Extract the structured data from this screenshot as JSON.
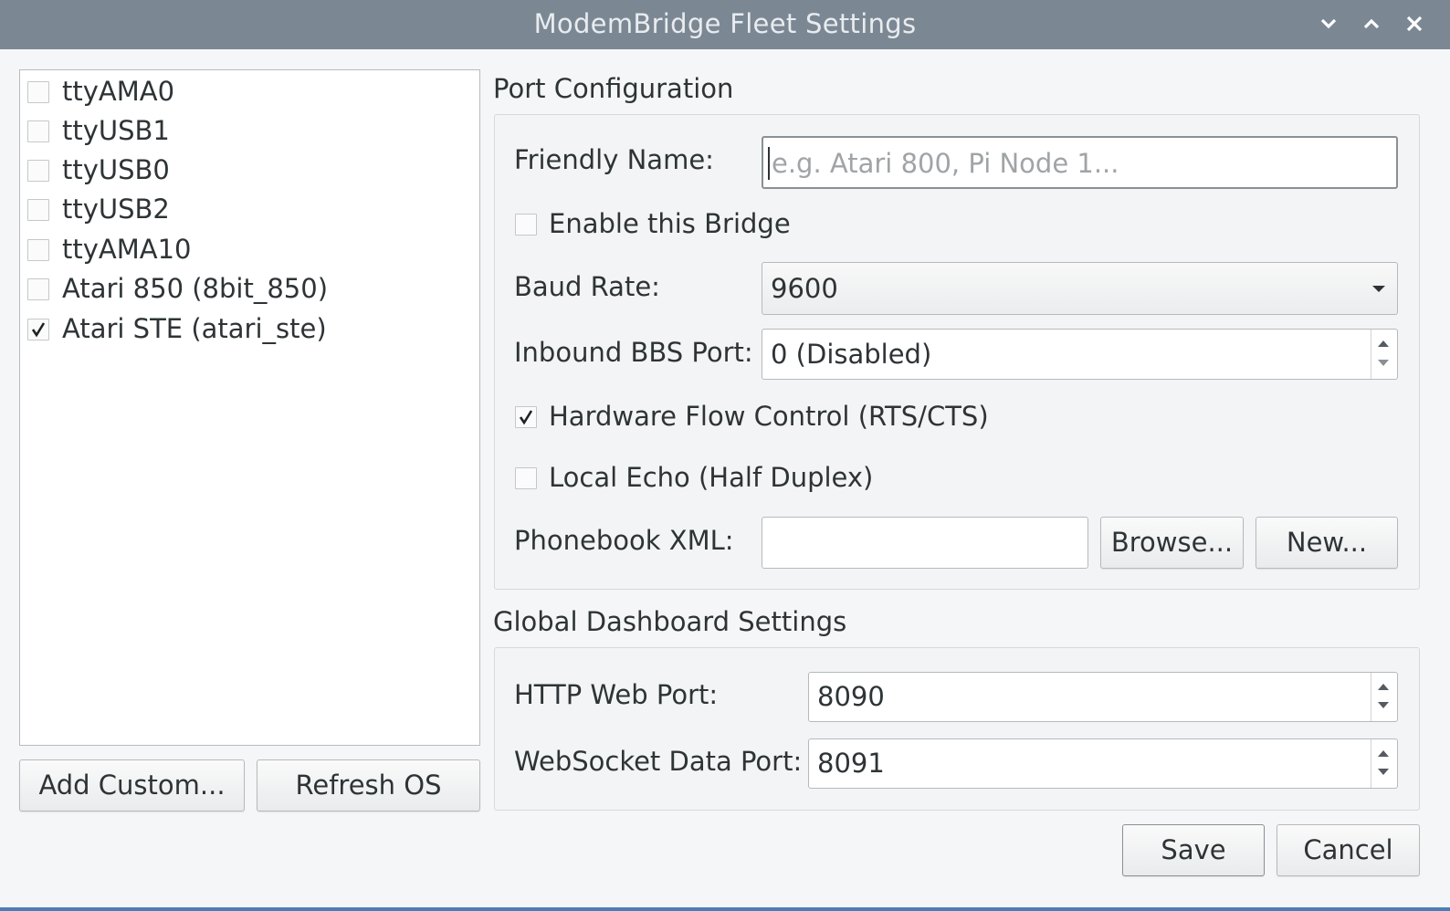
{
  "window": {
    "title": "ModemBridge Fleet Settings"
  },
  "devices": [
    {
      "label": "ttyAMA0",
      "checked": false
    },
    {
      "label": "ttyUSB1",
      "checked": false
    },
    {
      "label": "ttyUSB0",
      "checked": false
    },
    {
      "label": "ttyUSB2",
      "checked": false
    },
    {
      "label": "ttyAMA10",
      "checked": false
    },
    {
      "label": "Atari 850 (8bit_850)",
      "checked": false
    },
    {
      "label": "Atari STE (atari_ste)",
      "checked": true
    }
  ],
  "left_buttons": {
    "add_custom": "Add Custom...",
    "refresh_os": "Refresh OS"
  },
  "port_config": {
    "title": "Port Configuration",
    "friendly_name_label": "Friendly Name:",
    "friendly_name_value": "",
    "friendly_name_placeholder": "e.g. Atari 800, Pi Node 1...",
    "enable_label": "Enable this Bridge",
    "enable_checked": false,
    "baud_label": "Baud Rate:",
    "baud_value": "9600",
    "bbs_label": "Inbound BBS Port:",
    "bbs_value": "0 (Disabled)",
    "flow_label": "Hardware Flow Control (RTS/CTS)",
    "flow_checked": true,
    "echo_label": "Local Echo (Half Duplex)",
    "echo_checked": false,
    "phonebook_label": "Phonebook XML:",
    "phonebook_value": "",
    "browse_label": "Browse...",
    "new_label": "New..."
  },
  "global_settings": {
    "title": "Global Dashboard Settings",
    "http_label": "HTTP Web Port:",
    "http_value": "8090",
    "ws_label": "WebSocket Data Port:",
    "ws_value": "8091"
  },
  "dialog_buttons": {
    "save": "Save",
    "cancel": "Cancel"
  },
  "icons": {
    "minimize": "chevron-down-icon",
    "maximize": "chevron-up-icon",
    "close": "close-icon"
  }
}
